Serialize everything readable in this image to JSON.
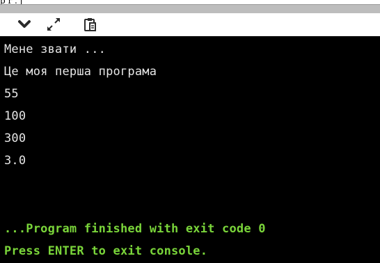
{
  "top_fragment": "p r . j",
  "toolbar": {
    "items": [
      {
        "name": "chevron-down-icon"
      },
      {
        "name": "expand-arrows-icon"
      },
      {
        "name": "clipboard-paste-icon"
      }
    ]
  },
  "console": {
    "lines": [
      {
        "text": "Мене звати ...",
        "kind": "output"
      },
      {
        "text": "Це моя перша програма",
        "kind": "output"
      },
      {
        "text": "55",
        "kind": "output"
      },
      {
        "text": "100",
        "kind": "output"
      },
      {
        "text": "300",
        "kind": "output"
      },
      {
        "text": "3.0",
        "kind": "output"
      },
      {
        "text": "",
        "kind": "output"
      },
      {
        "text": "...Program finished with exit code 0",
        "kind": "status"
      },
      {
        "text": "Press ENTER to exit console.",
        "kind": "status"
      }
    ]
  },
  "colors": {
    "console_bg": "#000000",
    "output_text": "#e6e6e6",
    "status_text": "#7ad53a"
  }
}
